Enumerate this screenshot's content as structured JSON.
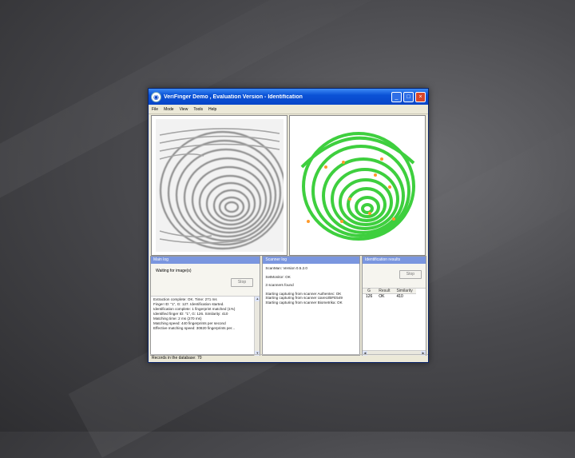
{
  "window": {
    "title": "VeriFinger Demo , Evaluation Version - Identification",
    "minimize": "_",
    "maximize": "□",
    "close": "×"
  },
  "menu": [
    "File",
    "Mode",
    "View",
    "Tools",
    "Help"
  ],
  "colors": {
    "title_bar": "#0846c8",
    "panel_header": "#7a96df",
    "fingerprint_green": "#3ecf3e",
    "minutiae": "#ff9a2a",
    "window_bg": "#ece9d8"
  },
  "main_log": {
    "title": "Main log",
    "status": "Waiting for image(s)",
    "stop_button": "Stop",
    "lines": [
      "Extraction complete: OK. Time: 271 ms",
      "Finger ID: \"1\", G: 127. Identification started.",
      "Identification complete: 1 fingerprint matched (1%)",
      "Identified finger ID: \"1\", G: 126. Similarity: 410",
      "Matching time: 2 ms (270 ms)",
      "Matching speed: 440 fingerprints per second",
      "Effective matching speed: 30820 fingerprints per..."
    ]
  },
  "scanner_log": {
    "title": "Scanner log",
    "lines": [
      "ScanMan: Version 0.5.2.0",
      "",
      "SetMonitor: OK",
      "",
      "3 scanners found",
      "",
      "Starting capturing from scanner Authentec: OK",
      "Starting capturing from scanner UareU/BFE549",
      "Starting capturing from scanner Biometrika: OK"
    ]
  },
  "identification_results": {
    "title": "Identification results",
    "stop_button": "Stop",
    "columns": [
      "G",
      "Result",
      "Similarity"
    ],
    "rows": [
      [
        "126",
        "OK",
        "410"
      ]
    ]
  },
  "status_bar": {
    "text": "Records in the database: 70"
  }
}
